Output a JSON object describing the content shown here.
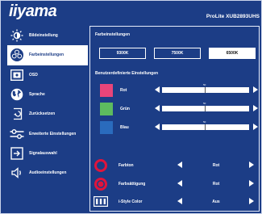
{
  "header": {
    "logo": "iiyama",
    "model": "ProLite XUB2893UHS"
  },
  "sidebar": {
    "items": [
      {
        "label": "Bildeinstellung",
        "icon": "brightness-icon",
        "active": false
      },
      {
        "label": "Farbeinstellungen",
        "icon": "palette-icon",
        "active": true
      },
      {
        "label": "OSD",
        "icon": "osd-icon",
        "active": false
      },
      {
        "label": "Sprache",
        "icon": "globe-icon",
        "active": false
      },
      {
        "label": "Zurücksetzen",
        "icon": "reset-icon",
        "active": false
      },
      {
        "label": "Erweiterte Einstellungen",
        "icon": "sliders-icon",
        "active": false
      },
      {
        "label": "Signalauswahl",
        "icon": "input-icon",
        "active": false
      },
      {
        "label": "Audioeinstellungen",
        "icon": "speaker-icon",
        "active": false
      }
    ]
  },
  "main": {
    "section_color": "Farbeinstellungen",
    "presets": [
      "9300K",
      "7500K",
      "6500K"
    ],
    "preset_selected": "6500K",
    "section_user": "Benutzerdefinierte Einstellungen",
    "channels": [
      {
        "label": "Rot",
        "value": "50",
        "fraction": 0.5,
        "color": "#e8457a"
      },
      {
        "label": "Grün",
        "value": "50",
        "fraction": 0.5,
        "color": "#5dbb5f"
      },
      {
        "label": "Blau",
        "value": "50",
        "fraction": 0.5,
        "color": "#2a6bbd"
      }
    ],
    "options": [
      {
        "label": "Farbton",
        "value": "Rot",
        "icon": "hue-ring-icon"
      },
      {
        "label": "Farbsättigung",
        "value": "Rot",
        "icon": "saturation-icon"
      },
      {
        "label": "i-Style Color",
        "value": "Aus",
        "icon": "istyle-icon"
      }
    ]
  },
  "colors": {
    "background": "#1c3d86",
    "text": "#ffffff",
    "accent_ring": "#e0143c"
  }
}
